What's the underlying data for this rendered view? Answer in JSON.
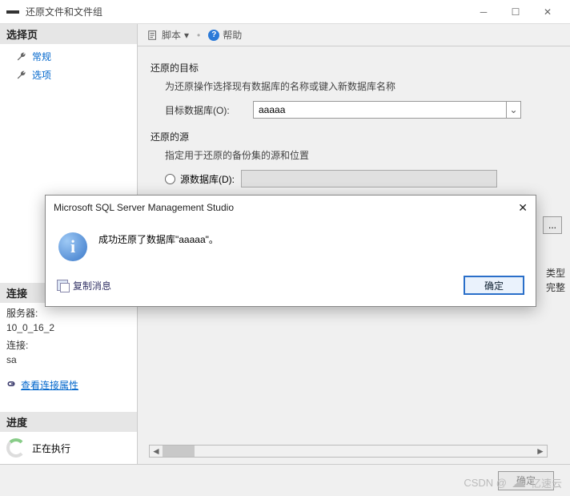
{
  "window": {
    "title": "还原文件和文件组"
  },
  "sidebar": {
    "select_header": "选择页",
    "items": [
      "常规",
      "选项"
    ],
    "connection_header": "连接",
    "server_label": "服务器:",
    "server_value": "10_0_16_2",
    "conn_label": "连接:",
    "conn_value": "sa",
    "view_conn_props": "查看连接属性",
    "progress_header": "进度",
    "progress_text": "正在执行"
  },
  "toolbar": {
    "script_label": "脚本",
    "dropdown": "▾",
    "help_label": "帮助"
  },
  "form": {
    "dest_title": "还原的目标",
    "dest_sub": "为还原操作选择现有数据库的名称或键入新数据库名称",
    "dest_db_label": "目标数据库(O):",
    "dest_db_value": "aaaaa",
    "src_title": "还原的源",
    "src_sub": "指定用于还原的备份集的源和位置",
    "src_db_radio": "源数据库(D):",
    "dots": "...",
    "fragment1": "类型",
    "fragment2": "完整"
  },
  "footer": {
    "ok": "确定"
  },
  "modal": {
    "title": "Microsoft SQL Server Management Studio",
    "message": "成功还原了数据库\"aaaaa\"。",
    "copy_label": "复制消息",
    "ok": "确定"
  },
  "watermark": {
    "prefix": "CSDN @",
    "brand": "亿速云"
  }
}
